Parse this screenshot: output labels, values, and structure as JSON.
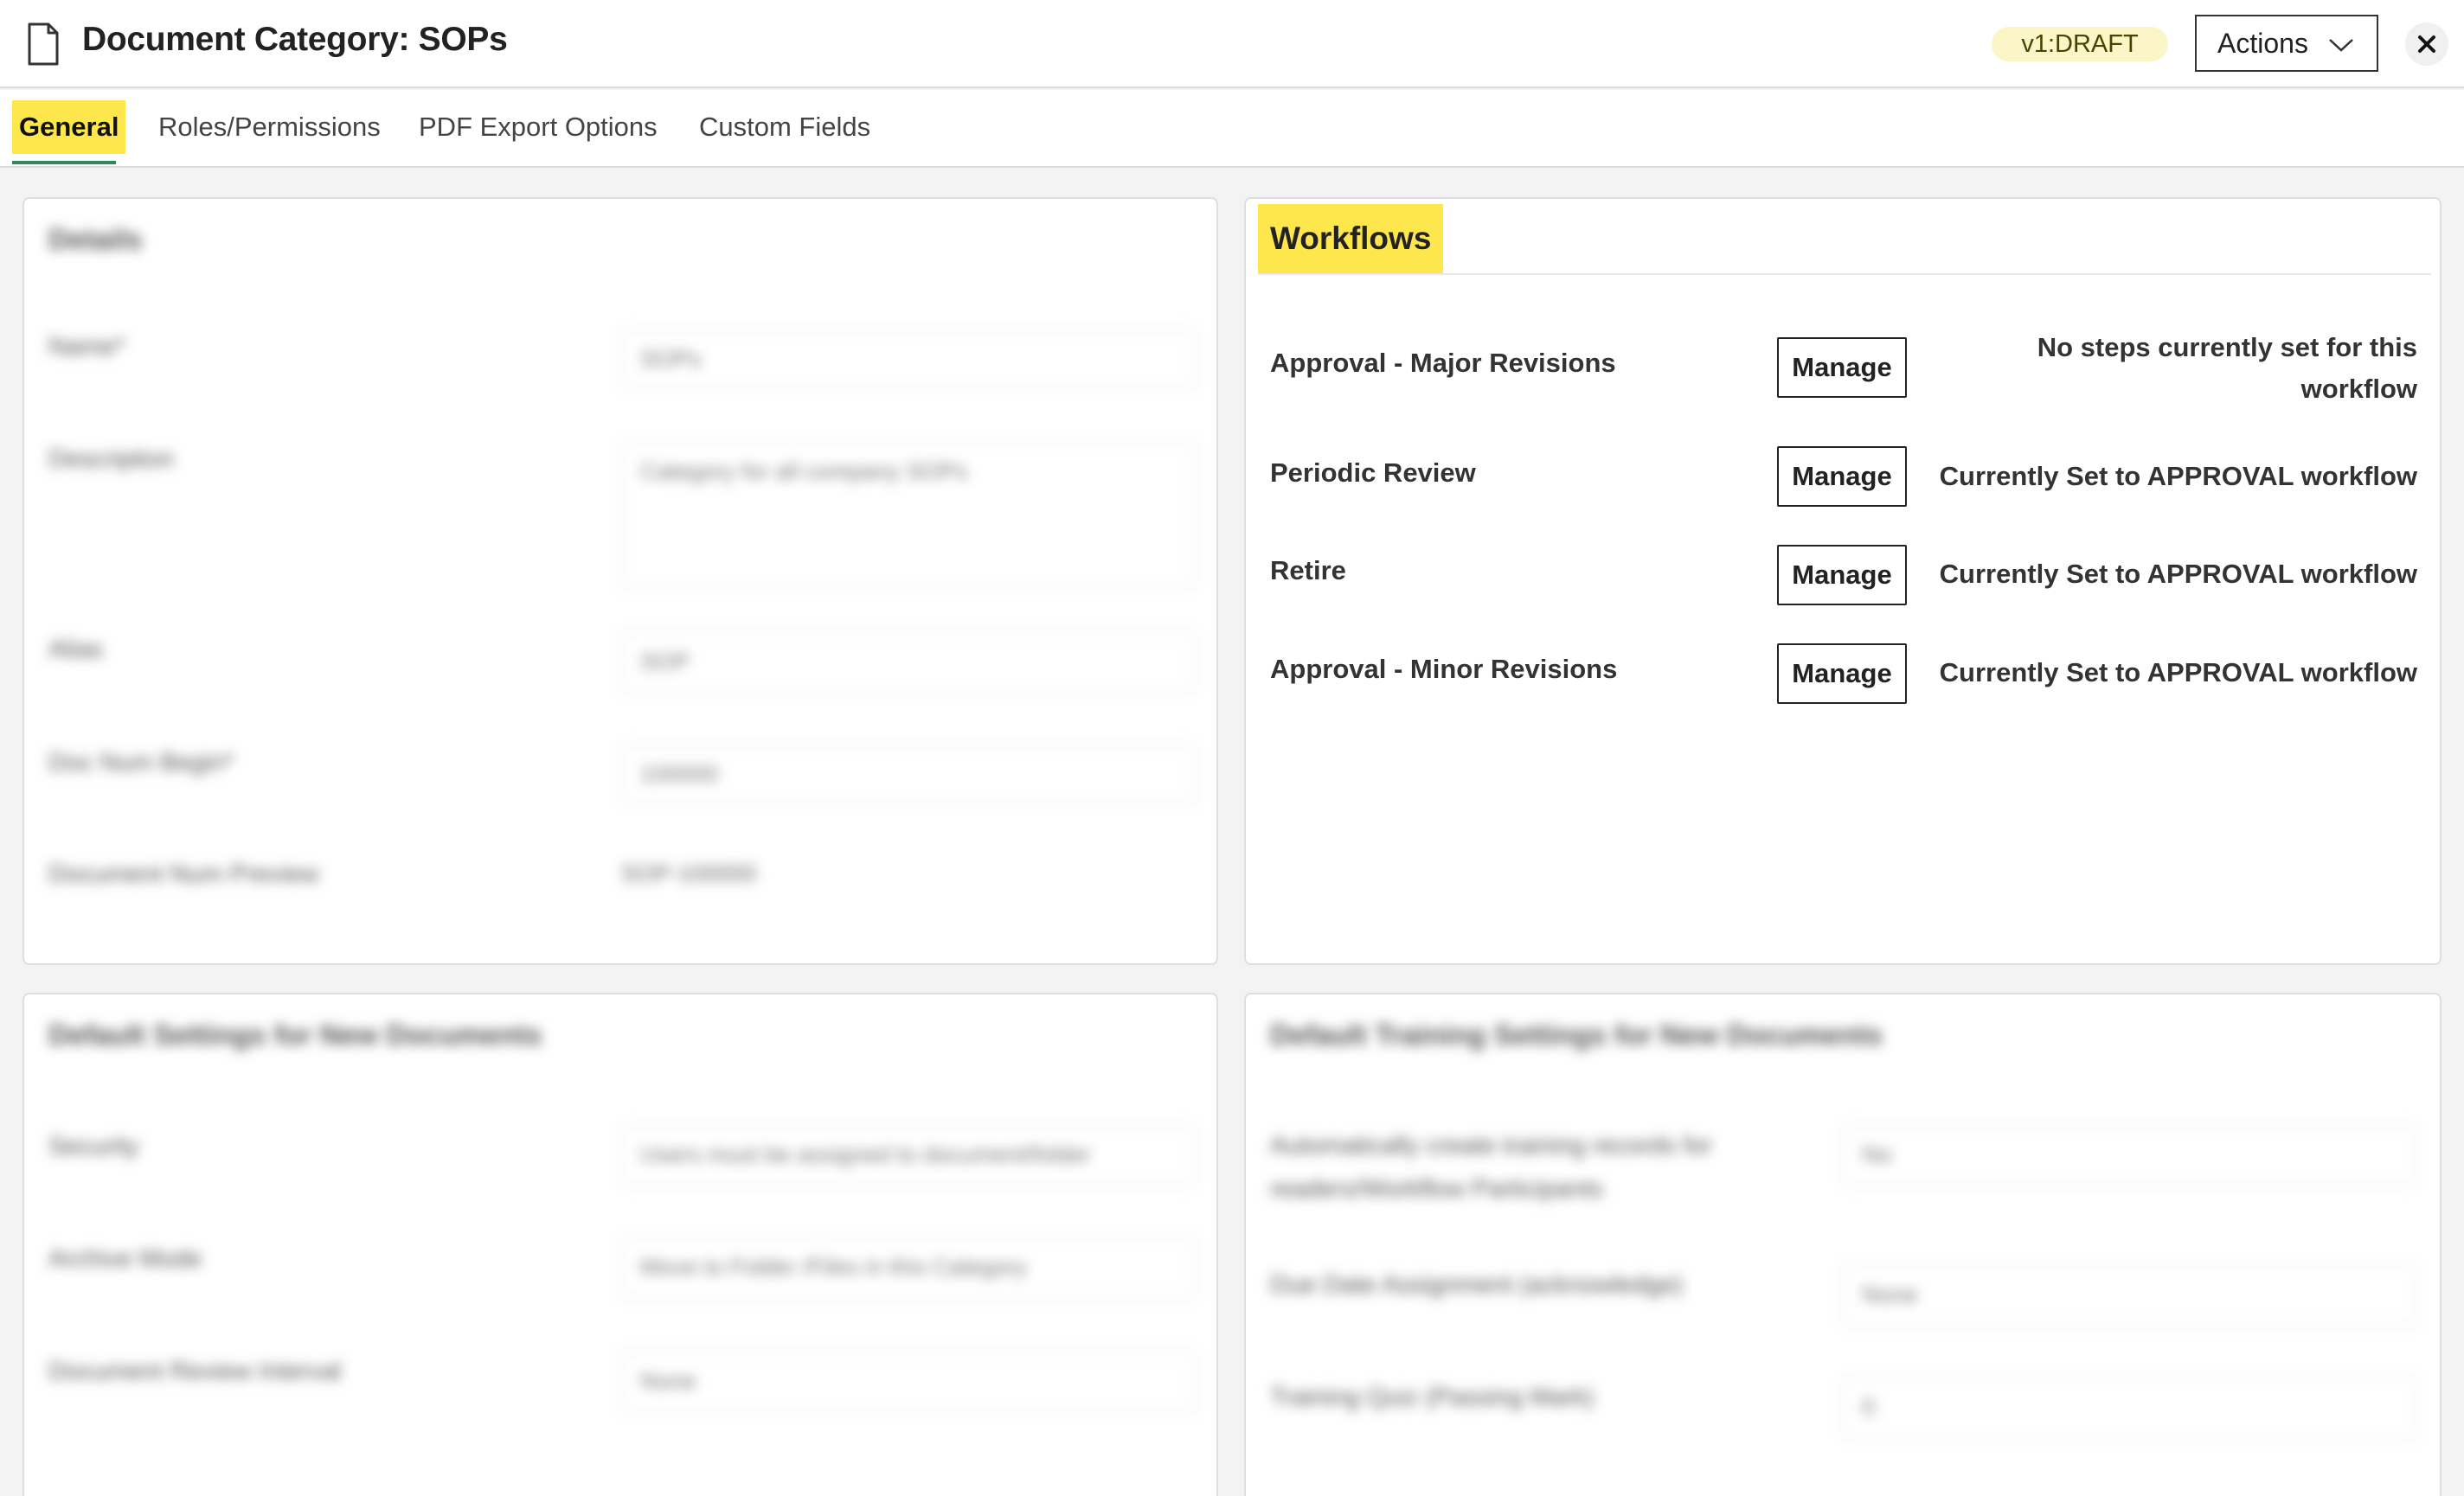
{
  "header": {
    "title": "Document Category: SOPs",
    "version": "v1:DRAFT",
    "actions_label": "Actions",
    "icon": "document-icon",
    "close_icon": "close-icon"
  },
  "tabs": [
    {
      "label": "General",
      "active": true
    },
    {
      "label": "Roles/Permissions",
      "active": false
    },
    {
      "label": "PDF Export Options",
      "active": false
    },
    {
      "label": "Custom Fields",
      "active": false
    }
  ],
  "details_panel": {
    "title": "Details",
    "fields": [
      {
        "label": "Name*",
        "value": "SOPs"
      },
      {
        "label": "Description",
        "value": "Category for all company SOPs"
      },
      {
        "label": "Alias",
        "value": "SOP"
      },
      {
        "label": "Doc Num Begin*",
        "value": "100000"
      },
      {
        "label": "Document Num Preview",
        "value": "SOP-100000"
      }
    ]
  },
  "workflows_panel": {
    "title": "Workflows",
    "manage_label": "Manage",
    "items": [
      {
        "name": "Approval - Major Revisions",
        "status": "No steps currently set for this workflow"
      },
      {
        "name": "Periodic Review",
        "status": "Currently Set to APPROVAL workflow"
      },
      {
        "name": "Retire",
        "status": "Currently Set to APPROVAL workflow"
      },
      {
        "name": "Approval - Minor Revisions",
        "status": "Currently Set to APPROVAL workflow"
      }
    ]
  },
  "defaults_panel": {
    "title": "Default Settings for New Documents",
    "fields": [
      {
        "label": "Security",
        "value": "Users must be assigned to document/folder"
      },
      {
        "label": "Archive Mode",
        "value": "Move to Folder /Files in this Category"
      },
      {
        "label": "Document Review Interval",
        "value": "None"
      }
    ]
  },
  "training_panel": {
    "title": "Default Training Settings for New Documents",
    "fields": [
      {
        "label": "Automatically create training records for readers/Workflow Participants",
        "value": "No"
      },
      {
        "label": "Due Date Assignment (acknowledge)",
        "value": "None"
      },
      {
        "label": "Training Quiz (Passing Mark)",
        "value": "0"
      }
    ]
  }
}
